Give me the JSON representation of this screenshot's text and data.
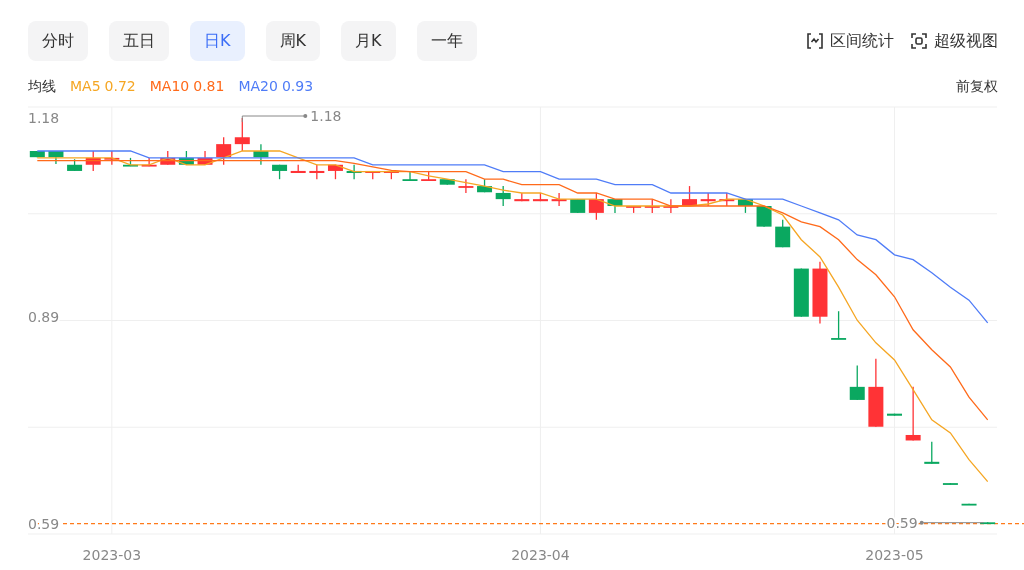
{
  "periods": [
    {
      "label": "分时",
      "selected": false
    },
    {
      "label": "五日",
      "selected": false
    },
    {
      "label": "日K",
      "selected": true
    },
    {
      "label": "周K",
      "selected": false
    },
    {
      "label": "月K",
      "selected": false
    },
    {
      "label": "一年",
      "selected": false
    }
  ],
  "tools": [
    {
      "kind": "range",
      "label": "区间统计"
    },
    {
      "kind": "view",
      "label": "超级视图"
    }
  ],
  "legend": {
    "title": "均线",
    "items": [
      {
        "value": "0.72"
      },
      {
        "value": "0.81"
      },
      {
        "value": "0.93"
      }
    ],
    "adjust": "前复权"
  },
  "chart_data": {
    "type": "candlestick",
    "ylim": [
      0.575,
      1.196
    ],
    "categories": [
      null,
      null,
      null,
      null,
      "2023-03",
      null,
      null,
      null,
      null,
      null,
      null,
      null,
      null,
      null,
      null,
      null,
      null,
      null,
      null,
      null,
      null,
      null,
      null,
      null,
      null,
      null,
      null,
      "2023-04",
      null,
      null,
      null,
      null,
      null,
      null,
      null,
      null,
      null,
      null,
      null,
      null,
      null,
      null,
      null,
      null,
      null,
      null,
      "2023-05",
      null,
      null,
      null,
      null,
      null
    ],
    "yticks": [
      1.18,
      0.89,
      0.59
    ],
    "grid": true,
    "ohlc": [
      [
        1.132,
        1.132,
        1.123,
        1.123
      ],
      [
        1.132,
        1.132,
        1.113,
        1.123
      ],
      [
        1.112,
        1.12,
        1.103,
        1.103
      ],
      [
        1.112,
        1.132,
        1.103,
        1.122
      ],
      [
        1.12,
        1.132,
        1.112,
        1.122
      ],
      [
        1.112,
        1.122,
        1.11,
        1.11
      ],
      [
        1.11,
        1.122,
        1.11,
        1.112
      ],
      [
        1.112,
        1.132,
        1.112,
        1.122
      ],
      [
        1.122,
        1.132,
        1.112,
        1.112
      ],
      [
        1.112,
        1.132,
        1.112,
        1.122
      ],
      [
        1.123,
        1.152,
        1.112,
        1.142
      ],
      [
        1.142,
        1.18,
        1.132,
        1.152
      ],
      [
        1.132,
        1.142,
        1.112,
        1.123
      ],
      [
        1.112,
        1.112,
        1.091,
        1.103
      ],
      [
        1.1,
        1.112,
        1.1,
        1.103
      ],
      [
        1.1,
        1.112,
        1.091,
        1.103
      ],
      [
        1.103,
        1.112,
        1.091,
        1.112
      ],
      [
        1.103,
        1.112,
        1.091,
        1.1
      ],
      [
        1.1,
        1.103,
        1.091,
        1.103
      ],
      [
        1.1,
        1.103,
        1.091,
        1.103
      ],
      [
        1.091,
        1.103,
        1.09,
        1.09
      ],
      [
        1.09,
        1.103,
        1.09,
        1.091
      ],
      [
        1.091,
        1.091,
        1.083,
        1.083
      ],
      [
        1.08,
        1.091,
        1.071,
        1.081
      ],
      [
        1.081,
        1.091,
        1.072,
        1.072
      ],
      [
        1.071,
        1.081,
        1.052,
        1.062
      ],
      [
        1.059,
        1.071,
        1.059,
        1.062
      ],
      [
        1.059,
        1.071,
        1.059,
        1.062
      ],
      [
        1.059,
        1.071,
        1.052,
        1.062
      ],
      [
        1.062,
        1.062,
        1.042,
        1.042
      ],
      [
        1.042,
        1.071,
        1.032,
        1.062
      ],
      [
        1.062,
        1.062,
        1.042,
        1.052
      ],
      [
        1.051,
        1.052,
        1.042,
        1.052
      ],
      [
        1.051,
        1.062,
        1.042,
        1.052
      ],
      [
        1.051,
        1.062,
        1.042,
        1.052
      ],
      [
        1.052,
        1.081,
        1.052,
        1.062
      ],
      [
        1.059,
        1.071,
        1.052,
        1.062
      ],
      [
        1.059,
        1.071,
        1.052,
        1.062
      ],
      [
        1.062,
        1.062,
        1.042,
        1.052
      ],
      [
        1.052,
        1.052,
        1.022,
        1.022
      ],
      [
        1.022,
        1.032,
        0.992,
        0.992
      ],
      [
        0.961,
        0.961,
        0.891,
        0.891
      ],
      [
        0.891,
        0.971,
        0.881,
        0.961
      ],
      [
        0.86,
        0.899,
        0.859,
        0.859
      ],
      [
        0.789,
        0.82,
        0.77,
        0.77
      ],
      [
        0.731,
        0.83,
        0.731,
        0.789
      ],
      [
        0.75,
        0.75,
        0.747,
        0.747
      ],
      [
        0.711,
        0.789,
        0.711,
        0.719
      ],
      [
        0.68,
        0.709,
        0.677,
        0.677
      ],
      [
        0.649,
        0.649,
        0.647,
        0.647
      ],
      [
        0.619,
        0.619,
        0.617,
        0.617
      ],
      [
        0.592,
        0.592,
        0.59,
        0.59
      ]
    ],
    "series": [
      {
        "name": "MA5",
        "type": "line",
        "color": "#f5a623",
        "values": [
          1.122,
          1.122,
          1.122,
          1.122,
          1.122,
          1.112,
          1.112,
          1.122,
          1.112,
          1.112,
          1.122,
          1.132,
          1.132,
          1.132,
          1.122,
          1.112,
          1.112,
          1.102,
          1.102,
          1.102,
          1.102,
          1.096,
          1.091,
          1.086,
          1.081,
          1.075,
          1.071,
          1.071,
          1.062,
          1.062,
          1.062,
          1.052,
          1.052,
          1.052,
          1.052,
          1.052,
          1.055,
          1.062,
          1.062,
          1.052,
          1.039,
          1.003,
          0.978,
          0.934,
          0.886,
          0.853,
          0.828,
          0.785,
          0.741,
          0.722,
          0.683,
          0.651
        ]
      },
      {
        "name": "MA10",
        "type": "line",
        "color": "#ff6a1a",
        "values": [
          1.118,
          1.118,
          1.118,
          1.118,
          1.118,
          1.118,
          1.118,
          1.118,
          1.118,
          1.118,
          1.118,
          1.118,
          1.118,
          1.118,
          1.118,
          1.118,
          1.118,
          1.114,
          1.109,
          1.104,
          1.102,
          1.102,
          1.102,
          1.102,
          1.091,
          1.091,
          1.083,
          1.083,
          1.083,
          1.071,
          1.071,
          1.062,
          1.062,
          1.062,
          1.052,
          1.052,
          1.052,
          1.052,
          1.052,
          1.052,
          1.042,
          1.029,
          1.022,
          1.003,
          0.974,
          0.952,
          0.92,
          0.872,
          0.843,
          0.818,
          0.774,
          0.741
        ]
      },
      {
        "name": "MA20",
        "type": "line",
        "color": "#4f7cf7",
        "values": [
          1.132,
          1.132,
          1.132,
          1.132,
          1.132,
          1.132,
          1.122,
          1.122,
          1.122,
          1.122,
          1.122,
          1.122,
          1.122,
          1.122,
          1.122,
          1.122,
          1.122,
          1.122,
          1.112,
          1.112,
          1.112,
          1.112,
          1.112,
          1.112,
          1.112,
          1.102,
          1.102,
          1.102,
          1.091,
          1.091,
          1.091,
          1.083,
          1.083,
          1.083,
          1.071,
          1.071,
          1.071,
          1.071,
          1.062,
          1.062,
          1.062,
          1.052,
          1.042,
          1.032,
          1.01,
          1.003,
          0.981,
          0.974,
          0.955,
          0.934,
          0.915,
          0.882
        ]
      }
    ],
    "ref_lines": [
      {
        "axis": "y",
        "value": 0.59,
        "color": "#ff7a1a"
      }
    ],
    "annotations": [
      "1.18",
      "0.59"
    ]
  }
}
